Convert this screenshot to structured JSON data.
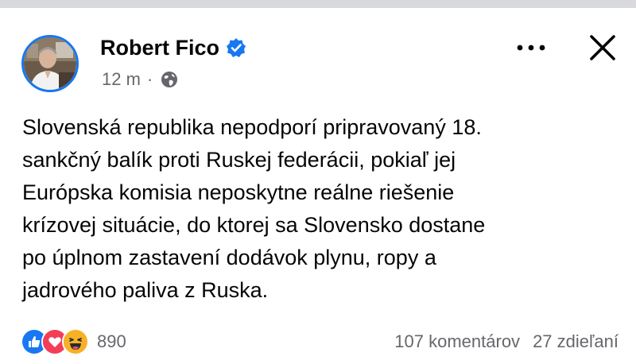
{
  "post": {
    "author": "Robert Fico",
    "verified": true,
    "time": "12 m",
    "separator": "·",
    "audience_icon": "globe-icon",
    "text_lines": [
      "Slovenská republika nepodporí pripravovaný 18.",
      "sankčný balík proti Ruskej federácii, pokiaľ jej",
      "Európska komisia neposkytne reálne riešenie",
      "krízovej situácie, do ktorej sa Slovensko dostane",
      "po úplnom zastavení dodávok plynu, ropy a",
      "jadrového paliva z Ruska."
    ]
  },
  "reactions": {
    "icons": [
      "like-icon",
      "love-icon",
      "haha-icon"
    ],
    "count": "890"
  },
  "stats": {
    "comments": "107 komentárov",
    "shares": "27 zdieľaní"
  },
  "colors": {
    "facebook_blue": "#1877f2",
    "text_primary": "#050505",
    "text_secondary": "#65676b",
    "love_red": "#f33e58",
    "haha_yellow": "#f7b125"
  }
}
